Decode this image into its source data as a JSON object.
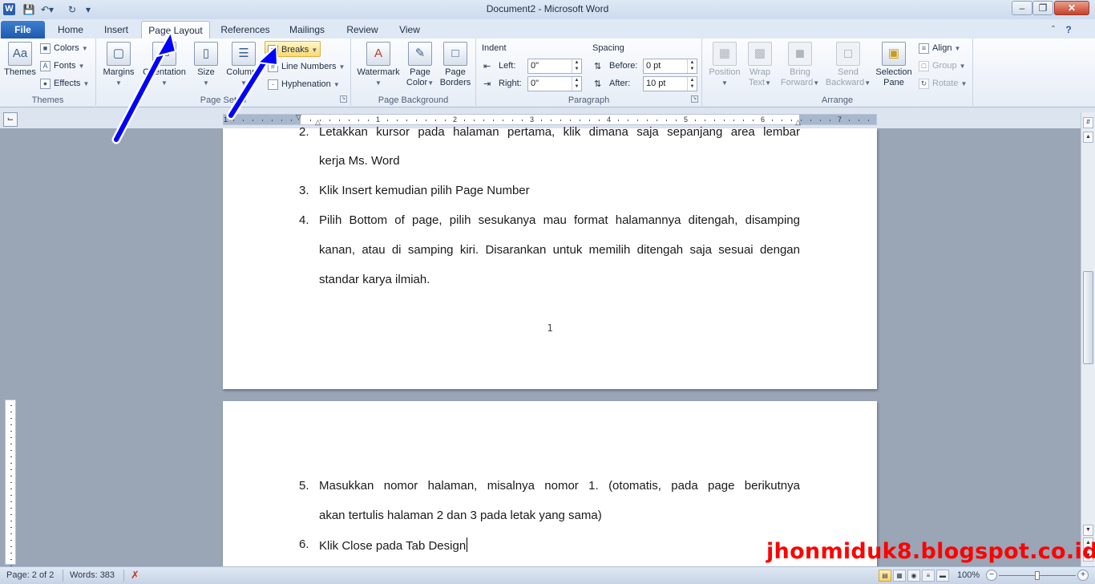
{
  "window": {
    "title": "Document2 - Microsoft Word",
    "app_icon": "W",
    "qat": [
      "save-icon",
      "undo-icon",
      "redo-icon",
      "customize-qat-icon"
    ],
    "controls": {
      "minimize": "–",
      "restore": "❐",
      "close": "✕"
    }
  },
  "tabs": [
    {
      "label": "File"
    },
    {
      "label": "Home"
    },
    {
      "label": "Insert"
    },
    {
      "label": "Page Layout"
    },
    {
      "label": "References"
    },
    {
      "label": "Mailings"
    },
    {
      "label": "Review"
    },
    {
      "label": "View"
    }
  ],
  "active_tab": "Page Layout",
  "ribbon": {
    "themes": {
      "label": "Themes",
      "themes_btn": "Themes",
      "colors": "Colors",
      "fonts": "Fonts",
      "effects": "Effects"
    },
    "page_setup": {
      "label": "Page Setup",
      "margins": "Margins",
      "orientation": "Orientation",
      "size": "Size",
      "columns": "Columns",
      "breaks": "Breaks",
      "line_numbers": "Line Numbers",
      "hyphenation": "Hyphenation"
    },
    "page_background": {
      "label": "Page Background",
      "watermark": "Watermark",
      "page_color_1": "Page",
      "page_color_2": "Color",
      "page_borders_1": "Page",
      "page_borders_2": "Borders"
    },
    "paragraph": {
      "label": "Paragraph",
      "indent_title": "Indent",
      "spacing_title": "Spacing",
      "left_label": "Left:",
      "left_value": "0\"",
      "right_label": "Right:",
      "right_value": "0\"",
      "before_label": "Before:",
      "before_value": "0 pt",
      "after_label": "After:",
      "after_value": "10 pt"
    },
    "arrange": {
      "label": "Arrange",
      "position": "Position",
      "wrap_1": "Wrap",
      "wrap_2": "Text",
      "bring_1": "Bring",
      "bring_2": "Forward",
      "send_1": "Send",
      "send_2": "Backward",
      "selection_1": "Selection",
      "selection_2": "Pane",
      "align": "Align",
      "group": "Group",
      "rotate": "Rotate"
    }
  },
  "ruler": {
    "numbers": [
      "1",
      "1",
      "2",
      "3",
      "4",
      "5",
      "6",
      "7"
    ]
  },
  "document": {
    "page1": {
      "items": [
        {
          "num": "2.",
          "lines": [
            "Letakkan kursor pada halaman pertama, klik dimana saja sepanjang area lembar",
            "kerja Ms. Word"
          ]
        },
        {
          "num": "3.",
          "lines": [
            "Klik Insert kemudian pilih Page Number"
          ]
        },
        {
          "num": "4.",
          "lines": [
            "Pilih Bottom of page, pilih sesukanya mau format halamannya ditengah, disamping",
            "kanan, atau di samping kiri. Disarankan untuk memilih ditengah saja sesuai dengan",
            "standar karya ilmiah."
          ]
        }
      ],
      "page_number": "1"
    },
    "page2": {
      "items": [
        {
          "num": "5.",
          "lines": [
            "Masukkan nomor halaman, misalnya nomor 1. (otomatis, pada page berikutnya",
            "akan tertulis halaman 2 dan 3 pada letak yang sama)"
          ]
        },
        {
          "num": "6.",
          "lines": [
            "Klik Close pada Tab Design"
          ]
        }
      ]
    }
  },
  "status": {
    "page": "Page: 2 of 2",
    "words": "Words: 383",
    "zoom": "100%",
    "zoom_level_percent": 100
  },
  "watermark_text": "jhonmiduk8.blogspot.co.id",
  "colors": {
    "arrow": "#0000ff",
    "watermark": "#ff0000",
    "file_tab": "#2b67b8",
    "breaks_highlight": "#ffd96e"
  }
}
